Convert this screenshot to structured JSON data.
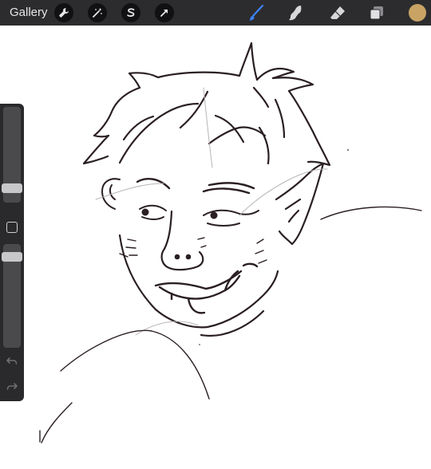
{
  "app": {
    "gallery_label": "Gallery"
  },
  "toolbar": {
    "left_tools": [
      "wrench-icon",
      "magic-wand-icon",
      "selection-icon",
      "transform-arrow-icon"
    ],
    "right_tools": [
      "brush-icon",
      "smudge-icon",
      "eraser-icon",
      "layers-icon",
      "color-swatch"
    ],
    "active_tool": "brush",
    "active_color": "#c9a363",
    "accent_color": "#3f83f8"
  },
  "sidebar": {
    "brush_size_level": 0.78,
    "opacity_level": 0.05,
    "buttons": [
      "modify-square-button",
      "undo-button",
      "redo-button"
    ]
  },
  "canvas": {
    "content": "sketch"
  }
}
